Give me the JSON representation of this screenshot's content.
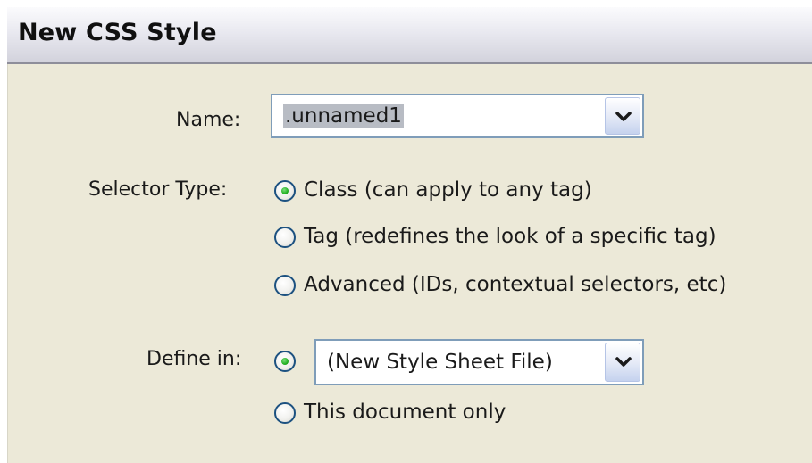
{
  "window": {
    "title": "New CSS Style"
  },
  "name": {
    "label": "Name:",
    "value": ".unnamed1",
    "dropdown_icon": "chevron-down-icon"
  },
  "selector_type": {
    "label": "Selector Type:",
    "options": [
      {
        "label": "Class (can apply to any tag)",
        "selected": true
      },
      {
        "label": "Tag (redefines the look of a specific tag)",
        "selected": false
      },
      {
        "label": "Advanced (IDs, contextual selectors, etc)",
        "selected": false
      }
    ]
  },
  "define_in": {
    "label": "Define in:",
    "new_file_selected": true,
    "new_file_value": "(New Style Sheet File)",
    "document_only_label": "This document only",
    "document_only_selected": false
  },
  "colors": {
    "radio_border": "#1c5180",
    "radio_dot": "#22b022",
    "combo_border": "#7f9db9",
    "panel_background": "#ece9d8"
  }
}
